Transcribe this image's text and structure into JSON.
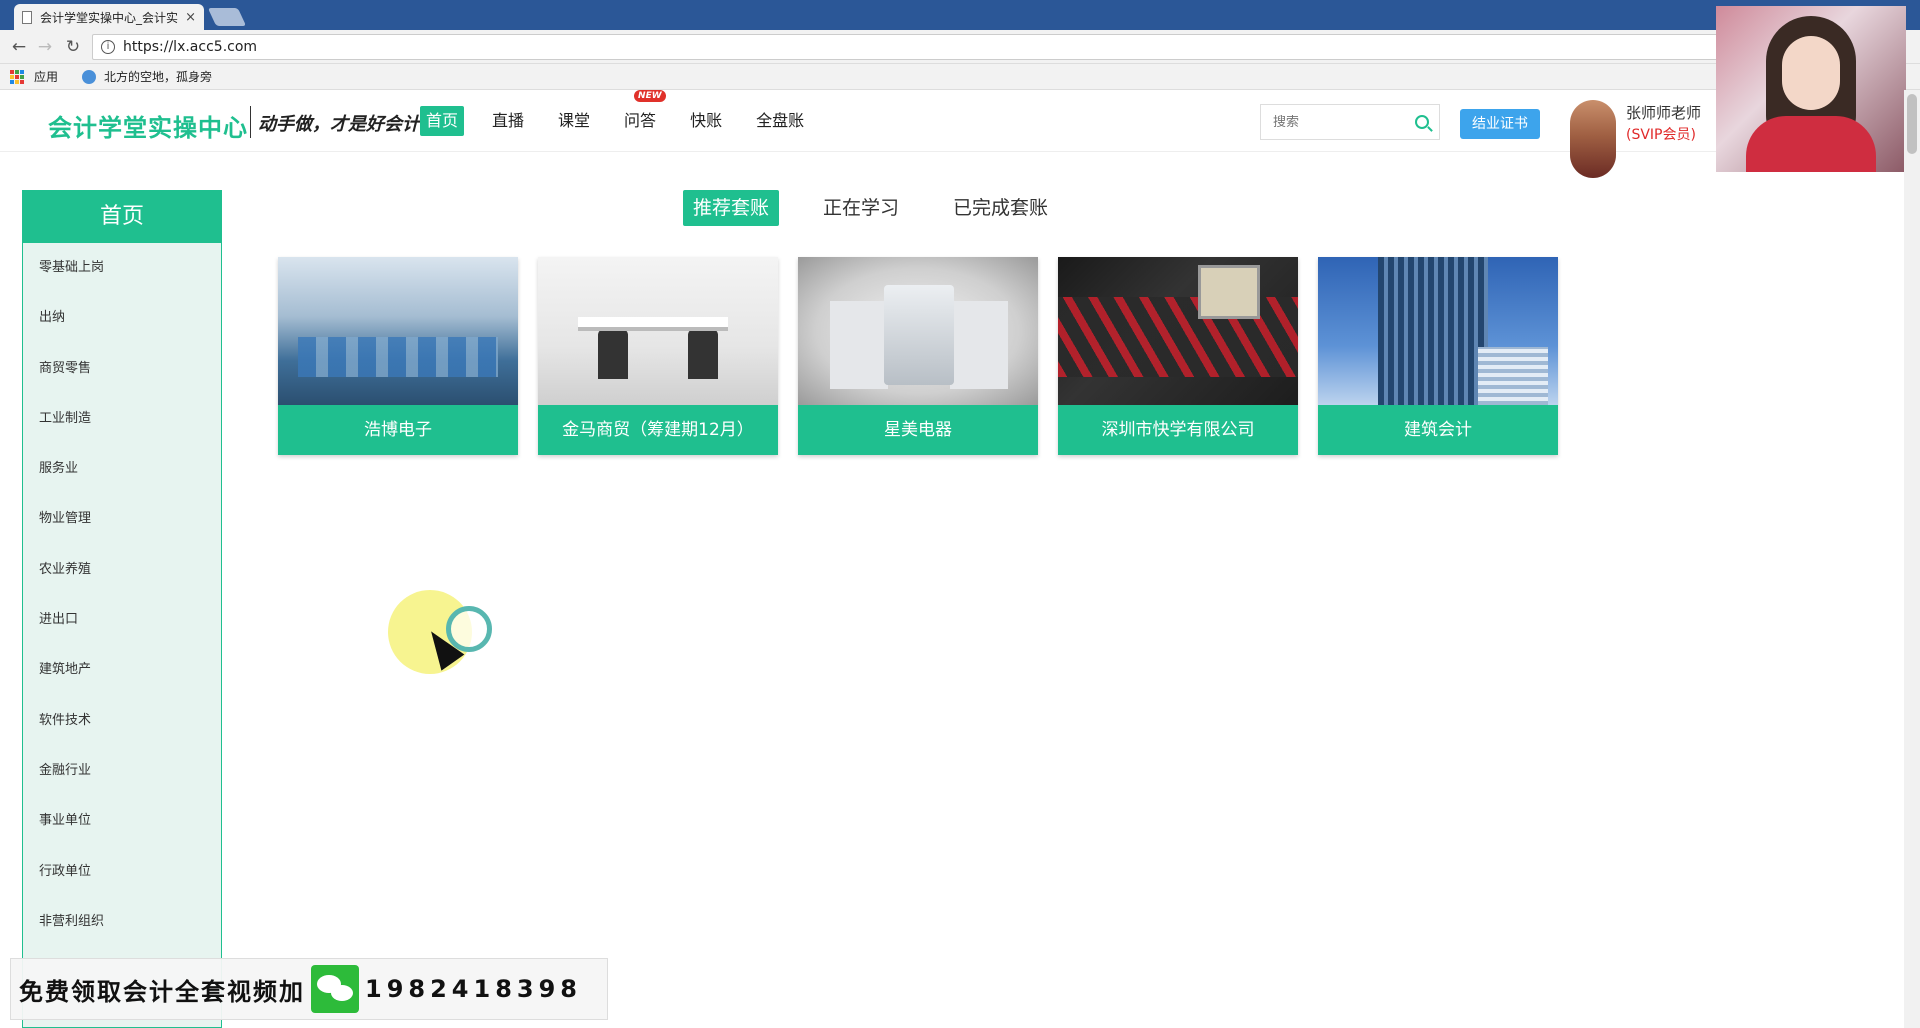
{
  "browser": {
    "tab_title": "会计学堂实操中心_会计实",
    "tab_close": "×",
    "url": "https://lx.acc5.com",
    "bookmarks": [
      {
        "label": "应用"
      },
      {
        "label": "北方的空地，孤身旁"
      }
    ]
  },
  "header": {
    "logo": "会计学堂实操中心",
    "slogan": "动手做，才是好会计",
    "nav": [
      {
        "label": "首页",
        "active": true
      },
      {
        "label": "直播"
      },
      {
        "label": "课堂"
      },
      {
        "label": "问答",
        "badge": "NEW"
      },
      {
        "label": "快账"
      },
      {
        "label": "全盘账"
      }
    ],
    "search_placeholder": "搜索",
    "cert_button": "结业证书",
    "user_name": "张师师老师",
    "user_level": "(SVIP会员)"
  },
  "sidebar": {
    "title": "首页",
    "items": [
      {
        "label": "零基础上岗"
      },
      {
        "label": "出纳"
      },
      {
        "label": "商贸零售"
      },
      {
        "label": "工业制造"
      },
      {
        "label": "服务业"
      },
      {
        "label": "物业管理"
      },
      {
        "label": "农业养殖"
      },
      {
        "label": "进出口"
      },
      {
        "label": "建筑地产"
      },
      {
        "label": "软件技术"
      },
      {
        "label": "金融行业"
      },
      {
        "label": "事业单位"
      },
      {
        "label": "行政单位"
      },
      {
        "label": "非营利组织"
      }
    ]
  },
  "main": {
    "tabs": [
      {
        "label": "推荐套账",
        "active": true
      },
      {
        "label": "正在学习"
      },
      {
        "label": "已完成套账"
      }
    ],
    "cards": [
      {
        "label": "浩博电子",
        "image": "factory-photo"
      },
      {
        "label": "金马商贸（筹建期12月）",
        "image": "office-photo"
      },
      {
        "label": "星美电器",
        "image": "water-heater-photo"
      },
      {
        "label": "深圳市快学有限公司",
        "image": "circuit-board-photo"
      },
      {
        "label": "建筑会计",
        "image": "skyscraper-photo"
      }
    ]
  },
  "promo": {
    "text": "免费领取会计全套视频加",
    "phone": "1982418398"
  },
  "colors": {
    "brand_green": "#1fbf8f",
    "cert_blue": "#3da4ec",
    "vip_red": "#e02a2a"
  }
}
